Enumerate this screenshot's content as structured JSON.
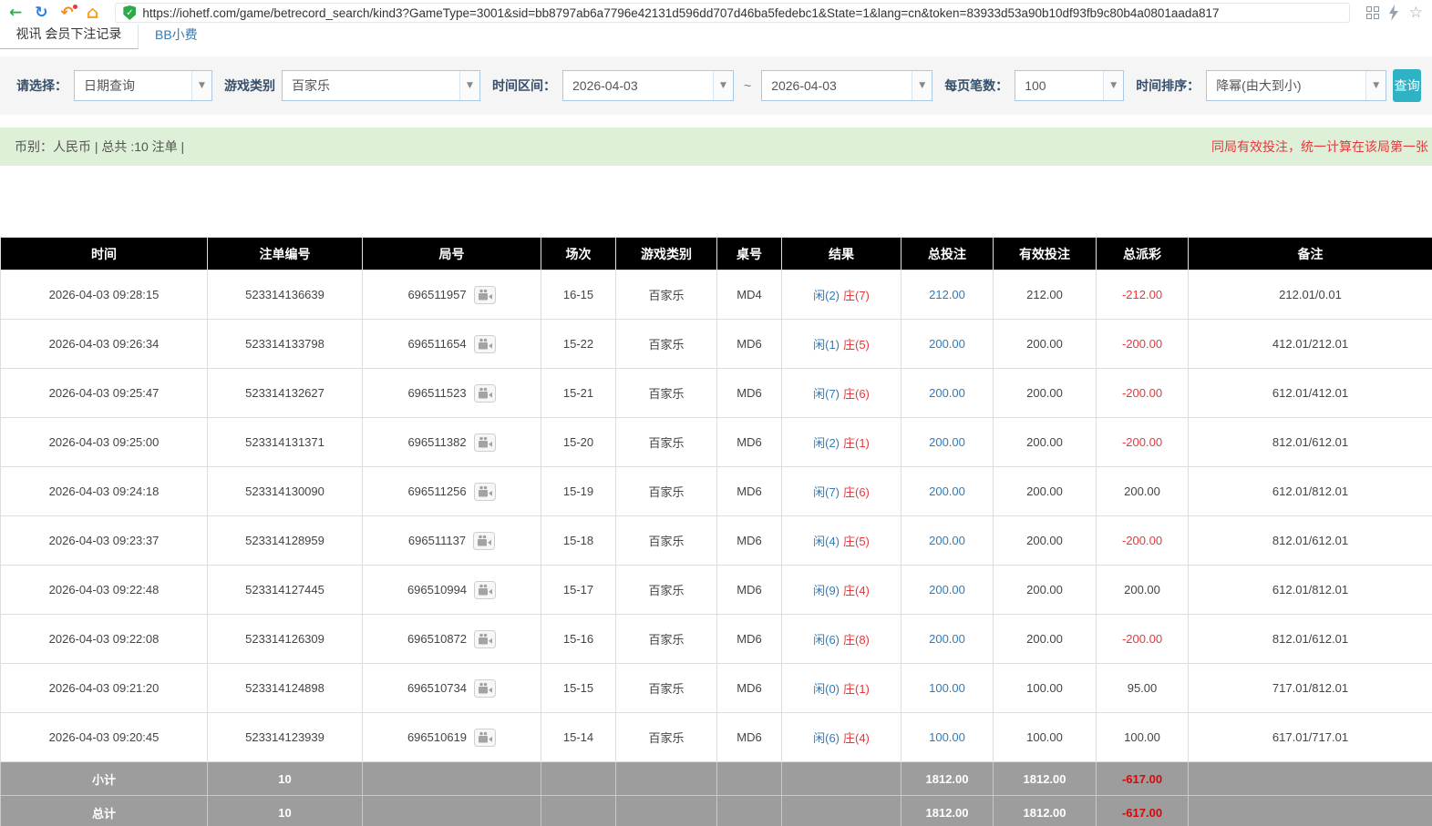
{
  "colors": {
    "accent_teal": "#2fb3c4",
    "link_blue": "#337ab7",
    "negative_red": "#e4393c",
    "notice_green_bg": "#dff0d8",
    "table_header_bg": "#000000",
    "summary_row_bg": "#9d9d9d"
  },
  "browser": {
    "url": "https://iohetf.com/game/betrecord_search/kind3?GameType=3001&sid=bb8797ab6a7796e42131d596dd707d46ba5fedebc1&State=1&lang=cn&token=83933d53a90b10df93fb9c80b4a0801aada817"
  },
  "tabs": {
    "record": "视讯 会员下注记录",
    "bb": "BB小费"
  },
  "filters": {
    "select_label": "请选择：",
    "query_type": "日期查询",
    "game_label": "游戏类别",
    "game_type": "百家乐",
    "range_label": "时间区间：",
    "date_from": "2026-04-03",
    "range_separator": "~",
    "date_to": "2026-04-03",
    "page_size_label": "每页笔数：",
    "page_size": "100",
    "sort_label": "时间排序：",
    "sort_order": "降幂(由大到小)",
    "search_button": "查询"
  },
  "notice": {
    "left": "币别：人民币 | 总共 :10 注单 |",
    "right": "同局有效投注，统一计算在该局第一张"
  },
  "table": {
    "headers": [
      "时间",
      "注单编号",
      "局号",
      "场次",
      "游戏类别",
      "桌号",
      "结果",
      "总投注",
      "有效投注",
      "总派彩",
      "备注"
    ],
    "rows": [
      {
        "time": "2026-04-03 09:28:15",
        "bet_id": "523314136639",
        "round": "696511957",
        "session": "16-15",
        "game": "百家乐",
        "table": "MD4",
        "player": "闲(2)",
        "banker": "庄(7)",
        "total_bet": "212.00",
        "valid_bet": "212.00",
        "payout": "-212.00",
        "note": "212.01/0.01"
      },
      {
        "time": "2026-04-03 09:26:34",
        "bet_id": "523314133798",
        "round": "696511654",
        "session": "15-22",
        "game": "百家乐",
        "table": "MD6",
        "player": "闲(1)",
        "banker": "庄(5)",
        "total_bet": "200.00",
        "valid_bet": "200.00",
        "payout": "-200.00",
        "note": "412.01/212.01"
      },
      {
        "time": "2026-04-03 09:25:47",
        "bet_id": "523314132627",
        "round": "696511523",
        "session": "15-21",
        "game": "百家乐",
        "table": "MD6",
        "player": "闲(7)",
        "banker": "庄(6)",
        "total_bet": "200.00",
        "valid_bet": "200.00",
        "payout": "-200.00",
        "note": "612.01/412.01"
      },
      {
        "time": "2026-04-03 09:25:00",
        "bet_id": "523314131371",
        "round": "696511382",
        "session": "15-20",
        "game": "百家乐",
        "table": "MD6",
        "player": "闲(2)",
        "banker": "庄(1)",
        "total_bet": "200.00",
        "valid_bet": "200.00",
        "payout": "-200.00",
        "note": "812.01/612.01"
      },
      {
        "time": "2026-04-03 09:24:18",
        "bet_id": "523314130090",
        "round": "696511256",
        "session": "15-19",
        "game": "百家乐",
        "table": "MD6",
        "player": "闲(7)",
        "banker": "庄(6)",
        "total_bet": "200.00",
        "valid_bet": "200.00",
        "payout": "200.00",
        "note": "612.01/812.01"
      },
      {
        "time": "2026-04-03 09:23:37",
        "bet_id": "523314128959",
        "round": "696511137",
        "session": "15-18",
        "game": "百家乐",
        "table": "MD6",
        "player": "闲(4)",
        "banker": "庄(5)",
        "total_bet": "200.00",
        "valid_bet": "200.00",
        "payout": "-200.00",
        "note": "812.01/612.01"
      },
      {
        "time": "2026-04-03 09:22:48",
        "bet_id": "523314127445",
        "round": "696510994",
        "session": "15-17",
        "game": "百家乐",
        "table": "MD6",
        "player": "闲(9)",
        "banker": "庄(4)",
        "total_bet": "200.00",
        "valid_bet": "200.00",
        "payout": "200.00",
        "note": "612.01/812.01"
      },
      {
        "time": "2026-04-03 09:22:08",
        "bet_id": "523314126309",
        "round": "696510872",
        "session": "15-16",
        "game": "百家乐",
        "table": "MD6",
        "player": "闲(6)",
        "banker": "庄(8)",
        "total_bet": "200.00",
        "valid_bet": "200.00",
        "payout": "-200.00",
        "note": "812.01/612.01"
      },
      {
        "time": "2026-04-03 09:21:20",
        "bet_id": "523314124898",
        "round": "696510734",
        "session": "15-15",
        "game": "百家乐",
        "table": "MD6",
        "player": "闲(0)",
        "banker": "庄(1)",
        "total_bet": "100.00",
        "valid_bet": "100.00",
        "payout": "95.00",
        "note": "717.01/812.01"
      },
      {
        "time": "2026-04-03 09:20:45",
        "bet_id": "523314123939",
        "round": "696510619",
        "session": "15-14",
        "game": "百家乐",
        "table": "MD6",
        "player": "闲(6)",
        "banker": "庄(4)",
        "total_bet": "100.00",
        "valid_bet": "100.00",
        "payout": "100.00",
        "note": "617.01/717.01"
      }
    ],
    "subtotal": {
      "label": "小计",
      "count": "10",
      "total_bet": "1812.00",
      "valid_bet": "1812.00",
      "payout": "-617.00"
    },
    "total": {
      "label": "总计",
      "count": "10",
      "total_bet": "1812.00",
      "valid_bet": "1812.00",
      "payout": "-617.00"
    }
  }
}
